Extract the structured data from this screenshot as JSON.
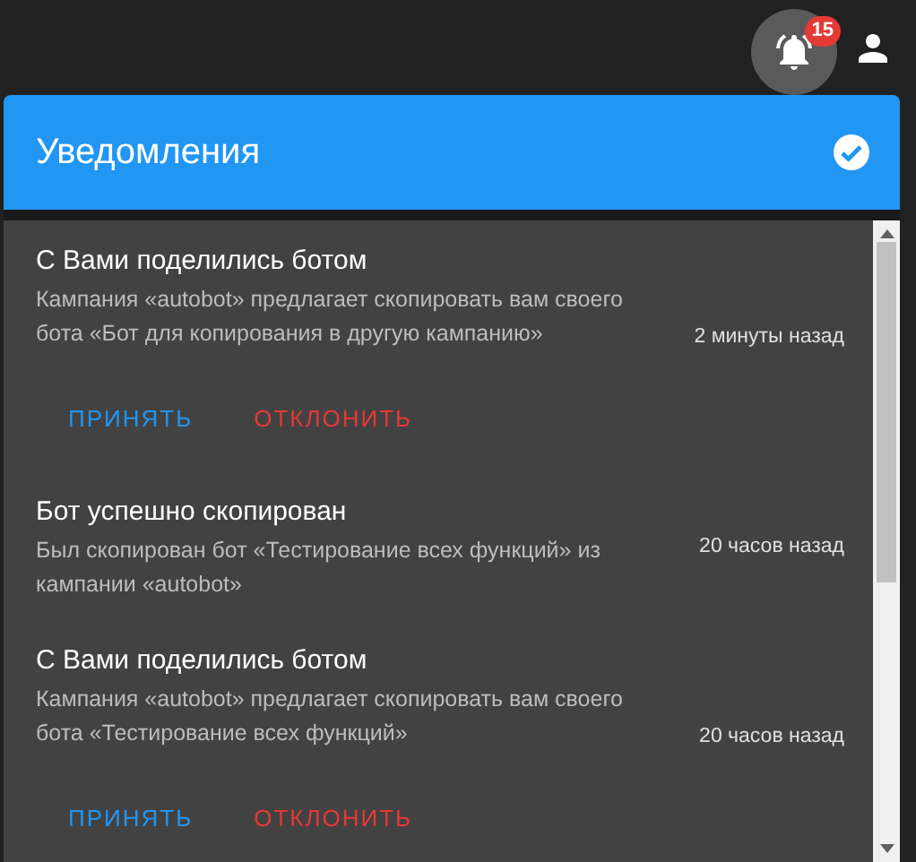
{
  "topbar": {
    "notification_count": "15"
  },
  "panel": {
    "title": "Уведомления"
  },
  "notifications": [
    {
      "kind": "share",
      "title": "С Вами поделились ботом",
      "body": "Кампания «autobot» предлагает скопировать вам своего бота «Бот для копирования в другую кампанию»",
      "time": "2 минуты назад",
      "actions": [
        "ПРИНЯТЬ",
        "ОТКЛОНИТЬ"
      ]
    },
    {
      "kind": "info",
      "title": "Бот успешно скопирован",
      "body": "Был скопирован бот «Тестирование всех функций» из кампании «autobot»",
      "time": "20 часов назад"
    },
    {
      "kind": "share",
      "title": "С Вами поделились ботом",
      "body": "Кампания «autobot» предлагает скопировать вам своего бота «Тестирование всех функций»",
      "time": "20 часов назад",
      "actions": [
        "ПРИНЯТЬ",
        "ОТКЛОНИТЬ"
      ]
    }
  ]
}
